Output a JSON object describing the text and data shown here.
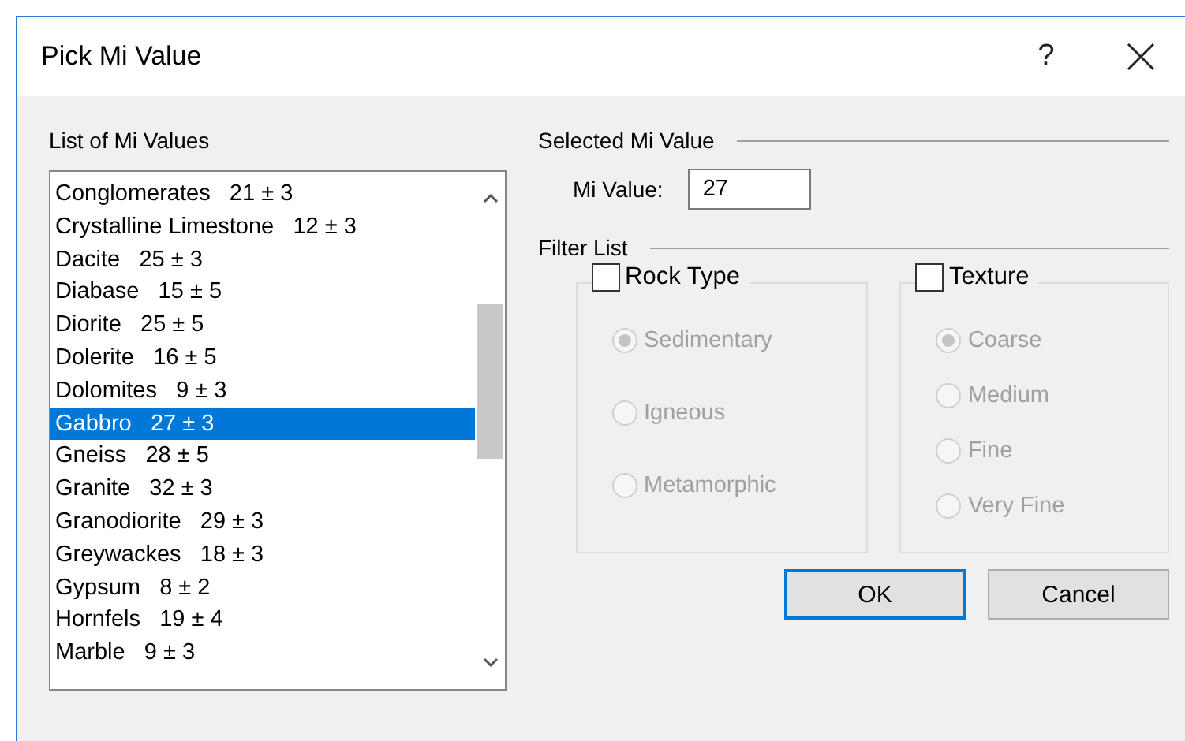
{
  "window": {
    "title": "Pick Mi Value",
    "help": "?"
  },
  "list": {
    "label": "List of Mi Values",
    "items": [
      {
        "name": "Conglomerates",
        "value": "21 ± 3",
        "selected": false
      },
      {
        "name": "Crystalline Limestone",
        "value": "12 ± 3",
        "selected": false
      },
      {
        "name": "Dacite",
        "value": "25 ± 3",
        "selected": false
      },
      {
        "name": "Diabase",
        "value": "15 ± 5",
        "selected": false
      },
      {
        "name": "Diorite",
        "value": "25 ± 5",
        "selected": false
      },
      {
        "name": "Dolerite",
        "value": "16 ± 5",
        "selected": false
      },
      {
        "name": "Dolomites",
        "value": "9 ± 3",
        "selected": false
      },
      {
        "name": "Gabbro",
        "value": "27 ± 3",
        "selected": true
      },
      {
        "name": "Gneiss",
        "value": "28 ± 5",
        "selected": false
      },
      {
        "name": "Granite",
        "value": "32 ± 3",
        "selected": false
      },
      {
        "name": "Granodiorite",
        "value": "29 ± 3",
        "selected": false
      },
      {
        "name": "Greywackes",
        "value": "18 ± 3",
        "selected": false
      },
      {
        "name": "Gypsum",
        "value": "8 ± 2",
        "selected": false
      },
      {
        "name": "Hornfels",
        "value": "19 ± 4",
        "selected": false
      },
      {
        "name": "Marble",
        "value": "9 ± 3",
        "selected": false
      }
    ]
  },
  "selected_section": {
    "title": "Selected Mi Value",
    "field_label": "Mi Value:",
    "value": "27"
  },
  "filter_section": {
    "title": "Filter List",
    "groups": [
      {
        "label": "Rock Type",
        "checked": false,
        "options": [
          {
            "label": "Sedimentary",
            "selected": true
          },
          {
            "label": "Igneous",
            "selected": false
          },
          {
            "label": "Metamorphic",
            "selected": false
          }
        ]
      },
      {
        "label": "Texture",
        "checked": false,
        "options": [
          {
            "label": "Coarse",
            "selected": true
          },
          {
            "label": "Medium",
            "selected": false
          },
          {
            "label": "Fine",
            "selected": false
          },
          {
            "label": "Very Fine",
            "selected": false
          }
        ]
      }
    ]
  },
  "buttons": [
    {
      "label": "OK",
      "default": true
    },
    {
      "label": "Cancel",
      "default": false
    }
  ]
}
